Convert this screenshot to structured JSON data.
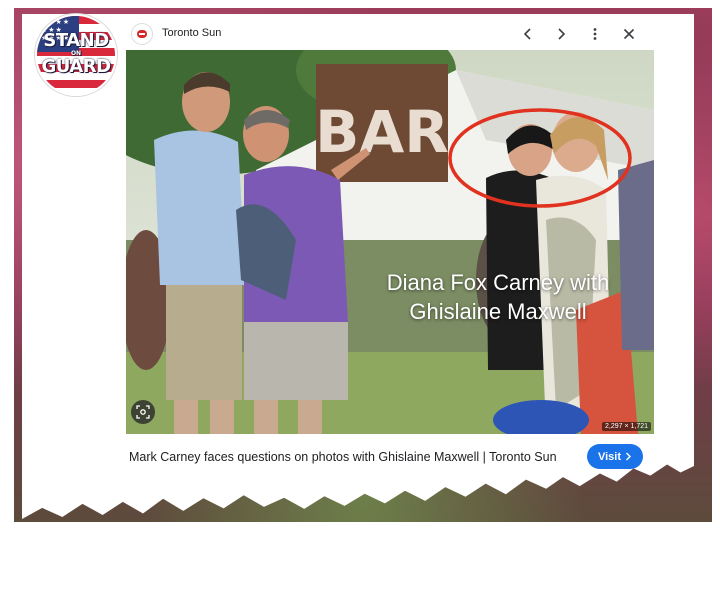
{
  "logo": {
    "line1": "STAND",
    "line2": "ON",
    "line3": "GUARD"
  },
  "viewer": {
    "source_name": "Toronto Sun",
    "icons": [
      "prev-arrow-icon",
      "next-arrow-icon",
      "more-vert-icon",
      "close-icon",
      "lens-icon"
    ]
  },
  "photo": {
    "sign_text": "BAR",
    "caption": "Diana Fox Carney with Ghislaine Maxwell",
    "dimensions": "2,297 × 1,721"
  },
  "footer": {
    "page_title": "Mark Carney faces questions on photos with Ghislaine Maxwell | Toronto Sun",
    "visit_label": "Visit"
  },
  "colors": {
    "accent": "#1a73e8",
    "highlight_circle": "#e0321e",
    "backdrop": "#8a3755"
  }
}
